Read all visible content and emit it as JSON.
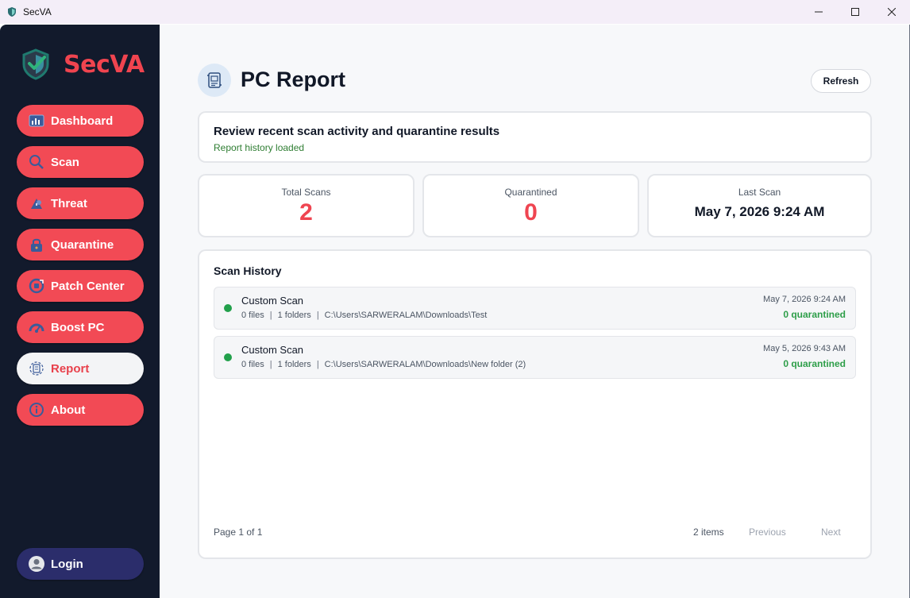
{
  "window": {
    "title": "SecVA",
    "icon": "shield-icon",
    "controls": [
      "minimize-icon",
      "maximize-icon",
      "close-icon"
    ]
  },
  "brand": {
    "name": "SecVA",
    "logo": "shield-logo",
    "color": "#f0444f"
  },
  "sidebar": {
    "background": "#121a2c",
    "accent": "#f24a55",
    "items": [
      {
        "label": "Dashboard",
        "icon": "dashboard-icon",
        "active": false
      },
      {
        "label": "Scan",
        "icon": "search-icon",
        "active": false
      },
      {
        "label": "Threat",
        "icon": "threat-icon",
        "active": false
      },
      {
        "label": "Quarantine",
        "icon": "lock-icon",
        "active": false
      },
      {
        "label": "Patch Center",
        "icon": "patch-icon",
        "active": false
      },
      {
        "label": "Boost PC",
        "icon": "speedometer-icon",
        "active": false
      },
      {
        "label": "Report",
        "icon": "report-icon",
        "active": true
      },
      {
        "label": "About",
        "icon": "info-icon",
        "active": false
      }
    ],
    "login": {
      "label": "Login",
      "icon": "user-icon",
      "color": "#2b2d6b"
    }
  },
  "page": {
    "title": "PC Report",
    "icon": "report-icon",
    "refresh_label": "Refresh"
  },
  "info": {
    "heading": "Review recent scan activity and quarantine results",
    "status": "Report history loaded"
  },
  "stats": {
    "total_scans": {
      "label": "Total Scans",
      "value": "2"
    },
    "quarantined": {
      "label": "Quarantined",
      "value": "0"
    },
    "last_scan": {
      "label": "Last Scan",
      "value": "May 7, 2026 9:24 AM"
    }
  },
  "history": {
    "title": "Scan History",
    "rows": [
      {
        "name": "Custom Scan",
        "files": "0 files",
        "folders": "1 folders",
        "path": "C:\\Users\\SARWERALAM\\Downloads\\Test",
        "date": "May 7, 2026 9:24 AM",
        "quarantined": "0 quarantined",
        "status_color": "#22a04b"
      },
      {
        "name": "Custom Scan",
        "files": "0 files",
        "folders": "1 folders",
        "path": "C:\\Users\\SARWERALAM\\Downloads\\New folder (2)",
        "date": "May 5, 2026 9:43 AM",
        "quarantined": "0 quarantined",
        "status_color": "#22a04b"
      }
    ],
    "pager": {
      "page_text": "Page 1 of 1",
      "count_text": "2 items",
      "previous_label": "Previous",
      "next_label": "Next"
    }
  }
}
